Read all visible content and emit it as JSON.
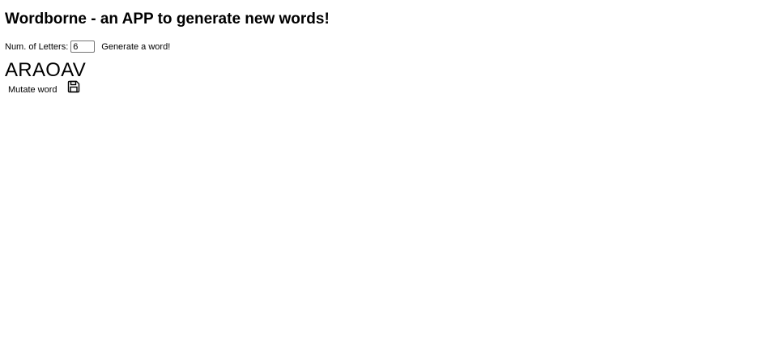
{
  "header": {
    "title": "Wordborne - an APP to generate new words!"
  },
  "controls": {
    "num_letters_label": "Num. of Letters:",
    "num_letters_value": "6",
    "generate_label": "Generate a word!"
  },
  "result": {
    "word": "ARAOAV",
    "mutate_label": "Mutate word",
    "save_icon": "floppy-disk-icon"
  }
}
